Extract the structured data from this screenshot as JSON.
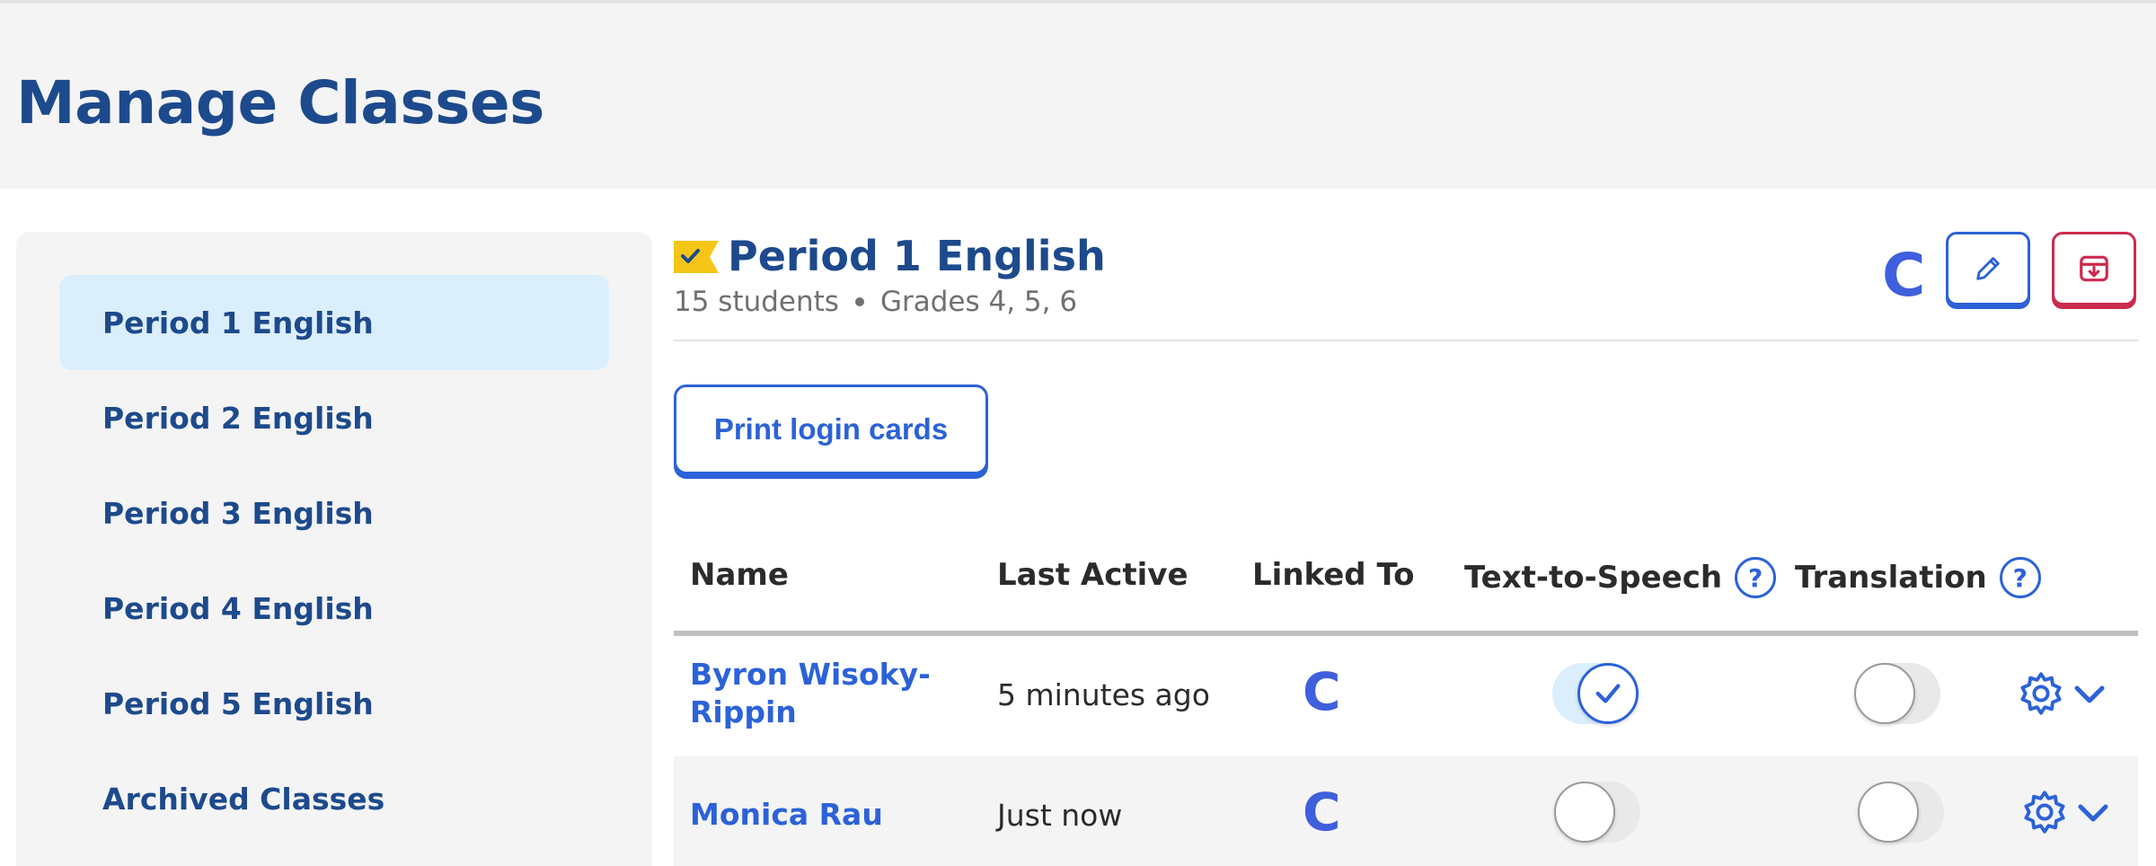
{
  "header": {
    "title": "Manage Classes"
  },
  "sidebar": {
    "items": [
      {
        "label": "Period 1 English",
        "active": true
      },
      {
        "label": "Period 2 English",
        "active": false
      },
      {
        "label": "Period 3 English",
        "active": false
      },
      {
        "label": "Period 4 English",
        "active": false
      },
      {
        "label": "Period 5 English",
        "active": false
      },
      {
        "label": "Archived Classes",
        "active": false
      }
    ]
  },
  "class": {
    "title": "Period 1 English",
    "students": "15 students",
    "grades": "Grades 4, 5, 6",
    "linked_icon": "clever-logo"
  },
  "actions": {
    "print_label": "Print login cards",
    "edit_icon": "pencil-icon",
    "archive_icon": "archive-box-icon"
  },
  "table": {
    "columns": [
      "Name",
      "Last Active",
      "Linked To",
      "Text-to-Speech",
      "Translation"
    ],
    "help_glyph": "?",
    "rows": [
      {
        "name": "Byron Wisoky-Rippin",
        "name_line1": "Byron Wisoky-",
        "name_line2": "Rippin",
        "last_active": "5 minutes ago",
        "linked_to": "clever-logo",
        "tts": true,
        "translation": false
      },
      {
        "name": "Monica Rau",
        "name_line1": "Monica Rau",
        "name_line2": "",
        "last_active": "Just now",
        "linked_to": "clever-logo",
        "tts": false,
        "translation": false
      }
    ]
  },
  "colors": {
    "primary": "#2c62d8",
    "heading": "#1d4a8c",
    "danger": "#cc2a4f",
    "flag": "#f5c518",
    "active_bg": "#dbeefc",
    "clever": "#3f5fdc"
  }
}
